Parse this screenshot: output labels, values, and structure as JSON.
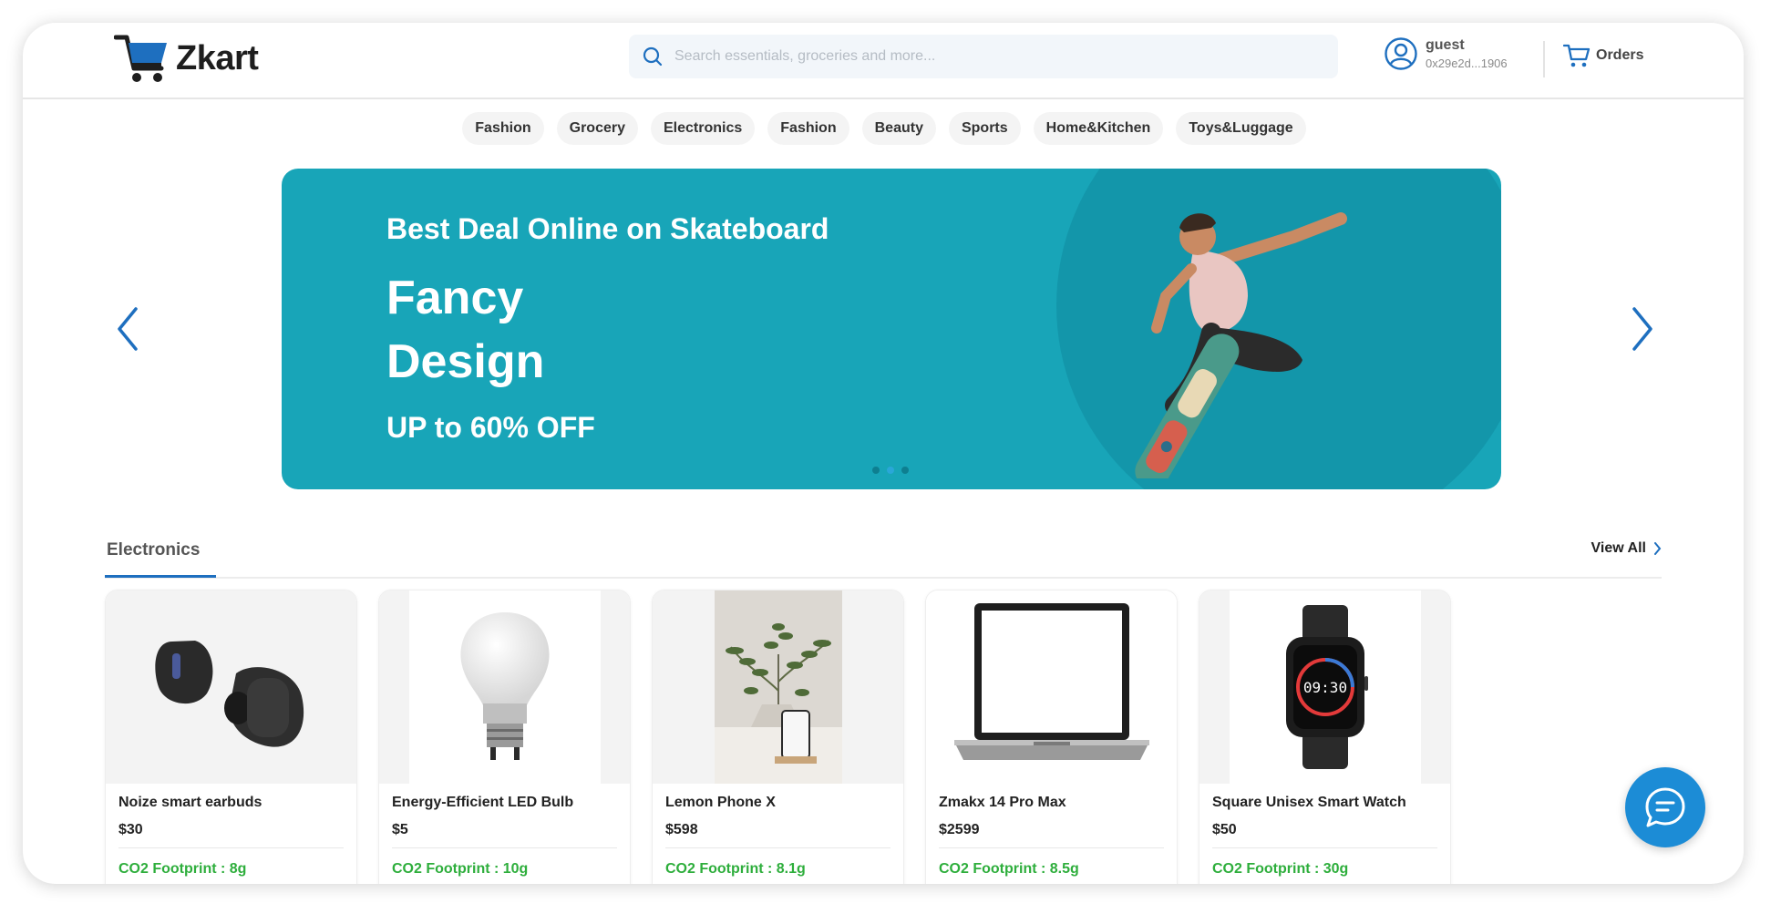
{
  "brand": {
    "name": "Zkart",
    "logo_icon": "cart-logo-icon",
    "accent": "#1e6fbf"
  },
  "search": {
    "placeholder": "Search essentials, groceries and more..."
  },
  "user": {
    "name": "guest",
    "address": "0x29e2d...1906",
    "icon": "user-circle-icon"
  },
  "orders": {
    "label": "Orders",
    "icon": "cart-icon"
  },
  "categories": [
    "Fashion",
    "Grocery",
    "Electronics",
    "Fashion",
    "Beauty",
    "Sports",
    "Home&Kitchen",
    "Toys&Luggage"
  ],
  "banner": {
    "subtitle": "Best Deal Online on Skateboard",
    "title_line1": "Fancy",
    "title_line2": "Design",
    "discount": "UP to 60% OFF",
    "background": "#18a5b8",
    "slide_count": 3,
    "active_slide": 2
  },
  "section": {
    "title": "Electronics",
    "view_all": "View All"
  },
  "products": [
    {
      "name": "Noize smart earbuds",
      "price": "$30",
      "co2": "CO2 Footprint : 8g",
      "image": "earbuds-image"
    },
    {
      "name": "Energy-Efficient LED Bulb",
      "price": "$5",
      "co2": "CO2 Footprint : 10g",
      "image": "bulb-image"
    },
    {
      "name": "Lemon Phone X",
      "price": "$598",
      "co2": "CO2 Footprint : 8.1g",
      "image": "phone-image"
    },
    {
      "name": "Zmakx 14 Pro Max",
      "price": "$2599",
      "co2": "CO2 Footprint : 8.5g",
      "image": "laptop-image"
    },
    {
      "name": "Square Unisex Smart Watch",
      "price": "$50",
      "co2": "CO2 Footprint : 30g",
      "image": "watch-image"
    }
  ],
  "chat": {
    "icon": "chat-icon",
    "color": "#1c8cd6"
  }
}
